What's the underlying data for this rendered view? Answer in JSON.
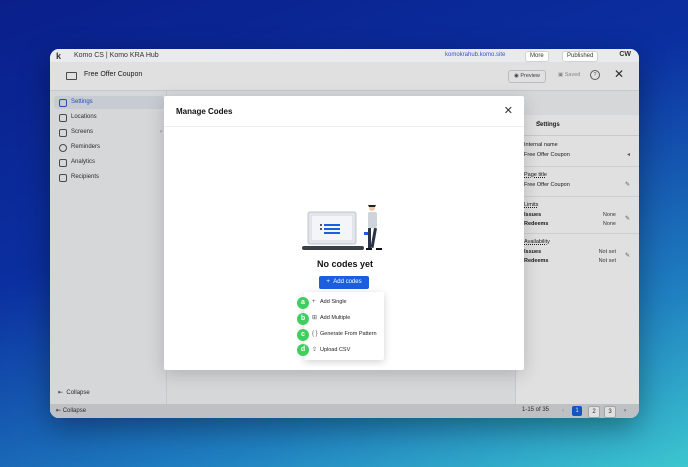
{
  "topbar": {
    "logo": "k",
    "brand": "Komo CS | Komo KRA Hub",
    "link": "komokrahub.komo.site",
    "more_label": "More",
    "published_label": "Published",
    "user_initials": "CW"
  },
  "header": {
    "title": "Free Offer Coupon",
    "preview_label": "Preview",
    "saved_label": "Saved"
  },
  "sidebar": {
    "items": [
      {
        "label": "Settings"
      },
      {
        "label": "Locations"
      },
      {
        "label": "Screens"
      },
      {
        "label": "Reminders"
      },
      {
        "label": "Analytics"
      },
      {
        "label": "Recipients"
      }
    ],
    "collapse_label": "Collapse"
  },
  "right_panel": {
    "heading": "Settings",
    "internal_name_label": "Internal name",
    "internal_name_value": "Free Offer Coupon",
    "page_title_label": "Page title",
    "page_title_value": "Free Offer Coupon",
    "limits_label": "Limits",
    "issues_label": "Issues",
    "issues_value": "None",
    "redeems_label": "Redeems",
    "redeems_value": "None",
    "availability_label": "Availability",
    "avail_issues_label": "Issues",
    "avail_issues_value": "Not set",
    "avail_redeems_label": "Redeems",
    "avail_redeems_value": "Not set"
  },
  "footer": {
    "collapse_label": "Collapse",
    "page_range": "1-15 of 35",
    "pages": [
      "1",
      "2",
      "3"
    ]
  },
  "modal": {
    "title": "Manage Codes",
    "empty_text": "No codes yet",
    "add_button": "Add codes",
    "menu": [
      {
        "badge": "a",
        "label": "Add Single"
      },
      {
        "badge": "b",
        "label": "Add Multiple"
      },
      {
        "badge": "c",
        "label": "Generate From Pattern"
      },
      {
        "badge": "d",
        "label": "Upload CSV"
      }
    ]
  },
  "colors": {
    "accent": "#1b5fdf",
    "badge": "#3ecf5e"
  }
}
